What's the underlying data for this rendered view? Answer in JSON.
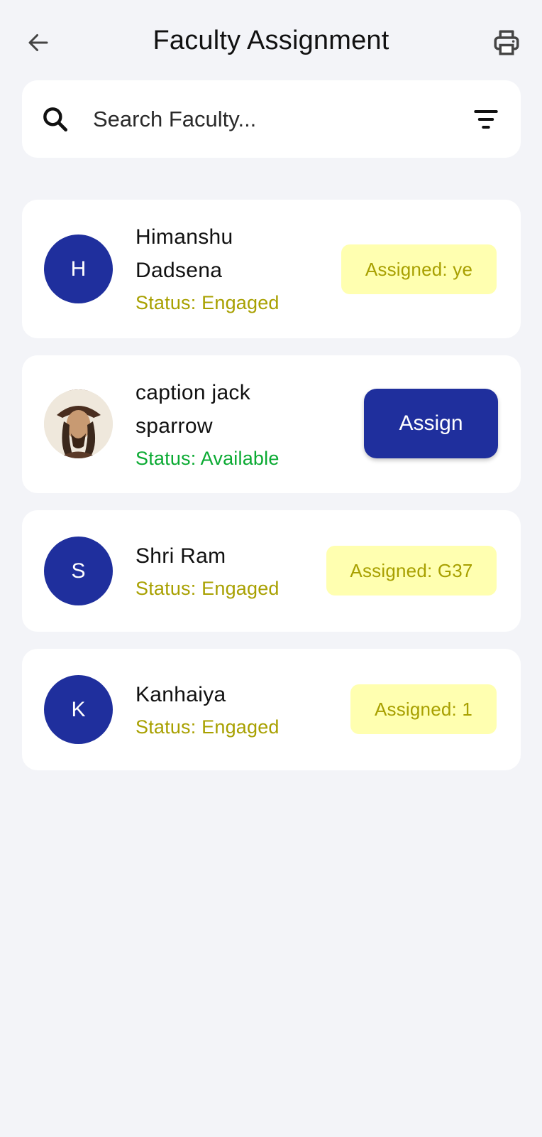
{
  "app_bar": {
    "title": "Faculty Assignment",
    "back_icon": "arrow-left-icon",
    "print_icon": "printer-icon"
  },
  "search": {
    "placeholder": "Search Faculty...",
    "value": "",
    "search_icon": "search-icon",
    "filter_icon": "filter-icon"
  },
  "faculty": [
    {
      "initial": "H",
      "name_line1": "Himanshu",
      "name_line2": "Dadsena",
      "status": "Status: Engaged",
      "assigned": "Assigned: ye"
    },
    {
      "avatar": "photo",
      "name_line1": "caption jack",
      "name_line2": "sparrow",
      "status": "Status: Available",
      "action": "Assign"
    },
    {
      "initial": "S",
      "name": "Shri Ram",
      "status": "Status: Engaged",
      "assigned": "Assigned: G37"
    },
    {
      "initial": "K",
      "name": "Kanhaiya",
      "status": "Status: Engaged",
      "assigned": "Assigned: 1"
    }
  ],
  "colors": {
    "background": "#f3f4f8",
    "card": "#ffffff",
    "primary": "#1f2f9d",
    "engaged": "#a8a000",
    "available": "#0aaa32",
    "assigned_badge_bg": "#ffffb0"
  }
}
